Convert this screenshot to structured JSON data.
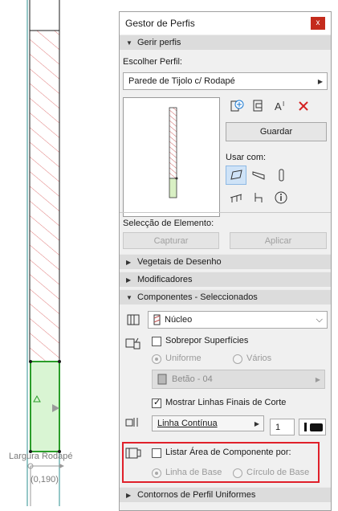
{
  "canvas": {
    "dimension_label": "Largura Rodapé",
    "coord_label": "(0,190)"
  },
  "panel": {
    "title": "Gestor de Perfis",
    "close_glyph": "x",
    "gerir": {
      "section_label": "Gerir perfis",
      "choose_label": "Escolher Perfil:",
      "profile_value": "Parede de Tijolo c/ Rodapé",
      "save_label": "Guardar",
      "use_with_label": "Usar com:"
    },
    "element": {
      "label": "Selecção de Elemento:",
      "capture_label": "Capturar",
      "apply_label": "Aplicar"
    },
    "sections": {
      "vegetais": "Vegetais de Desenho",
      "modificadores": "Modificadores",
      "componentes": "Componentes - Seleccionados",
      "contornos": "Contornos de Perfil Uniformes"
    },
    "componentes": {
      "component_value": "Núcleo",
      "override_label": "Sobrepor Superfícies",
      "uniform_label": "Uniforme",
      "various_label": "Vários",
      "material_value": "Betão - 04",
      "show_lines_label": "Mostrar Linhas Finais de Corte",
      "line_type_value": "Linha Contínua",
      "pen_value": "1",
      "list_area_label": "Listar Área de Componente por:",
      "baseline_label": "Linha de Base",
      "basecircle_label": "Círculo de Base"
    }
  }
}
